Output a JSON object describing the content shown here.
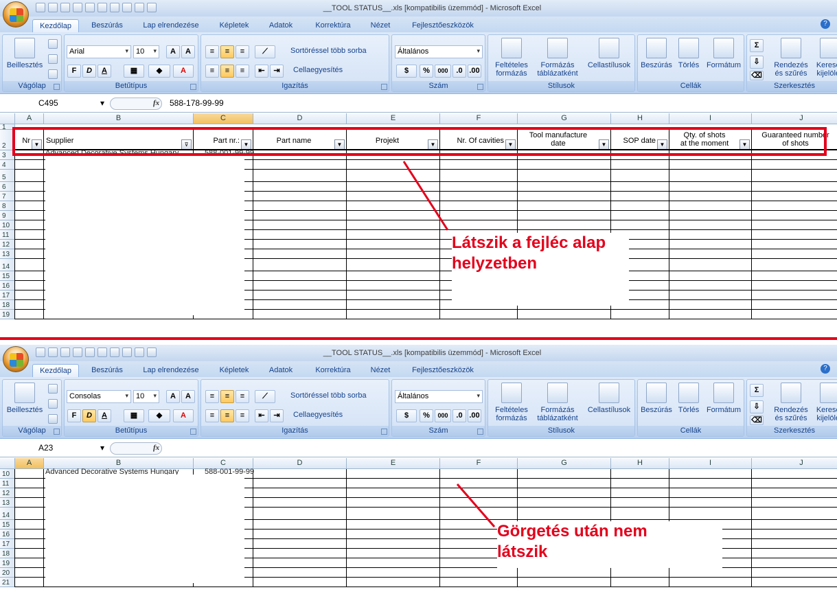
{
  "title": "__TOOL STATUS__.xls  [kompatibilis üzemmód] - Microsoft Excel",
  "tabs": [
    "Kezdőlap",
    "Beszúrás",
    "Lap elrendezése",
    "Képletek",
    "Adatok",
    "Korrektúra",
    "Nézet",
    "Fejlesztőeszközök"
  ],
  "ribbon": {
    "clipboard": {
      "paste": "Beillesztés",
      "label": "Vágólap"
    },
    "font": {
      "label": "Betűtípus",
      "size": "10",
      "bold": "F",
      "italic": "D",
      "underline": "A"
    },
    "alignment": {
      "wrap": "Sortöréssel több sorba",
      "merge": "Cellaegyesítés",
      "label": "Igazítás"
    },
    "number": {
      "format": "Általános",
      "percent": "%",
      "thousands": "000",
      "label": "Szám"
    },
    "styles": {
      "cond": "Feltételes formázás",
      "table": "Formázás táblázatként",
      "cell": "Cellastílusok",
      "label": "Stílusok"
    },
    "cells": {
      "insert": "Beszúrás",
      "delete": "Törlés",
      "format": "Formátum",
      "label": "Cellák"
    },
    "editing": {
      "sort": "Rendezés és szűrés",
      "find": "Keresés kijelölés",
      "label": "Szerkesztés"
    }
  },
  "panes": [
    {
      "font": "Arial",
      "namebox": "C495",
      "formula": "588-178-99-99",
      "rows": [
        "1",
        "2",
        "3",
        "4",
        "5",
        "6",
        "7",
        "8",
        "9",
        "10",
        "11",
        "12",
        "13",
        "14",
        "15",
        "16",
        "17",
        "18",
        "19"
      ],
      "annotation": [
        "Látszik a fejléc alap",
        "helyzetben"
      ]
    },
    {
      "font": "Consolas",
      "namebox": "A23",
      "formula": "",
      "rows": [
        "10",
        "11",
        "12",
        "13",
        "14",
        "15",
        "16",
        "17",
        "18",
        "19",
        "20",
        "21"
      ],
      "annotation": [
        "Görgetés után nem",
        "látszik"
      ]
    }
  ],
  "columns": [
    "A",
    "B",
    "C",
    "D",
    "E",
    "F",
    "G",
    "H",
    "I",
    "J"
  ],
  "headers": {
    "nr": "Nr",
    "supplier": "Supplier",
    "part_nr": "Part nr.:",
    "part_name": "Part name",
    "projekt": "Projekt",
    "cavities": "Nr. Of cavities",
    "tool_date": [
      "Tool manufacture",
      "date"
    ],
    "sop": "SOP date",
    "qty": [
      "Qty. of shots",
      "at the moment"
    ],
    "guaranteed": [
      "Guaranteed number",
      "of shots"
    ]
  },
  "cells": {
    "supplier_partial": "Advanced Decorative Systems Hungary",
    "partnr_partial": "588-001-99-99"
  },
  "colors": {
    "highlight": "#e3001b",
    "ribbon": "#c6daf3",
    "selected_header": "#f1c15f"
  }
}
